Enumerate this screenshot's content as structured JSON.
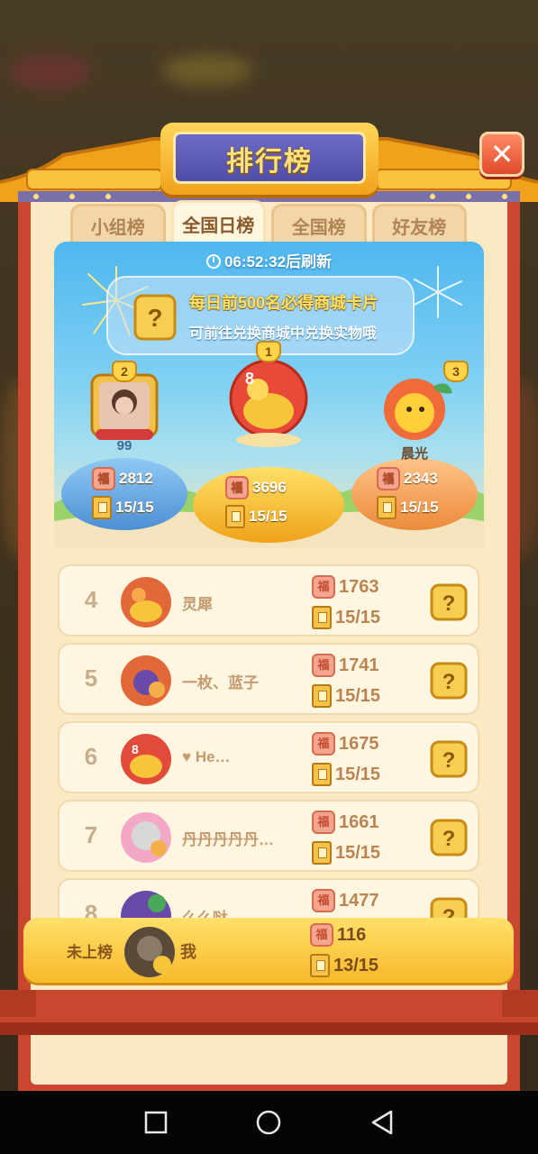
{
  "modal": {
    "title": "排行榜",
    "close_icon": "close-icon"
  },
  "tabs": [
    {
      "label": "小组榜",
      "active": false
    },
    {
      "label": "全国日榜",
      "active": true
    },
    {
      "label": "全国榜",
      "active": false
    },
    {
      "label": "好友榜",
      "active": false
    }
  ],
  "banner": {
    "timer": "06:52:32后刷新",
    "notice_line1": "每日前500名必得商城卡片",
    "notice_line2": "可前往兑换商城中兑换实物哦"
  },
  "podium": [
    {
      "rank": "2",
      "name": "99",
      "score": "2812",
      "progress": "15/15"
    },
    {
      "rank": "1",
      "name": "",
      "score": "3696",
      "progress": "15/15"
    },
    {
      "rank": "3",
      "name": "晨光",
      "score": "2343",
      "progress": "15/15"
    }
  ],
  "fu_label": "福",
  "ranking": [
    {
      "rank": "4",
      "name": "灵犀",
      "score": "1763",
      "progress": "15/15"
    },
    {
      "rank": "5",
      "name": "一枚、蓝子",
      "score": "1741",
      "progress": "15/15"
    },
    {
      "rank": "6",
      "name": "♥ He…",
      "score": "1675",
      "progress": "15/15"
    },
    {
      "rank": "7",
      "name": "丹丹丹丹丹…",
      "score": "1661",
      "progress": "15/15"
    },
    {
      "rank": "8",
      "name": "么么哒",
      "score": "1477",
      "progress": ""
    }
  ],
  "me": {
    "status": "未上榜",
    "name": "我",
    "score": "116",
    "progress": "13/15"
  },
  "colors": {
    "frame_red": "#c9472e",
    "panel_cream": "#fbe9c3",
    "title_purple": "#5554b0",
    "gold": "#f7b92a"
  }
}
